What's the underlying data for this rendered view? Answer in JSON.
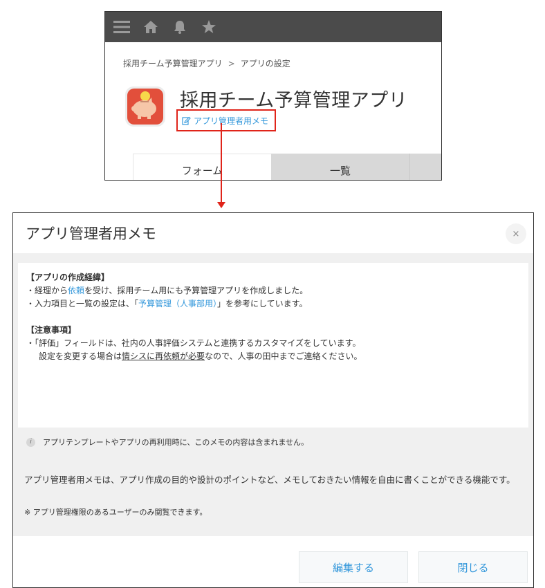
{
  "app_screen": {
    "breadcrumb": {
      "app": "採用チーム予算管理アプリ",
      "separator": ">",
      "current": "アプリの設定"
    },
    "app_title": "採用チーム予算管理アプリ",
    "memo_link_label": "アプリ管理者用メモ",
    "tabs": [
      {
        "label": "フォーム",
        "active": true
      },
      {
        "label": "一覧",
        "active": false
      }
    ],
    "topbar_icons": [
      "menu-icon",
      "home-icon",
      "bell-icon",
      "star-icon"
    ],
    "topbar_color": "#4b4b4b",
    "highlight_color": "#e0241a"
  },
  "dialog": {
    "title": "アプリ管理者用メモ",
    "close_symbol": "×",
    "memo": {
      "heading1": "【アプリの作成経緯】",
      "line1_pre": "・経理から",
      "line1_link": "依頼",
      "line1_post": "を受け、採用チーム用にも予算管理アプリを作成しました。",
      "line2_pre": "・入力項目と一覧の設定は、「",
      "line2_link": "予算管理（人事部用）",
      "line2_post": "」を参考にしています。",
      "heading2": "【注意事項】",
      "line3": "・「評価」フィールドは、社内の人事評価システムと連携するカスタマイズをしています。",
      "line4_pre": "設定を変更する場合は",
      "line4_underline": "情シスに再依頼が必要",
      "line4_post": "なので、人事の田中までご連絡ください。"
    },
    "note_icon": "info-icon",
    "note_text": "アプリテンプレートやアプリの再利用時に、このメモの内容は含まれません。",
    "description": "アプリ管理者用メモは、アプリ作成の目的や設計のポイントなど、メモしておきたい情報を自由に書くことができる機能です。",
    "permission_note": "※ アプリ管理権限のあるユーザーのみ閲覧できます。",
    "buttons": {
      "edit": "編集する",
      "close": "閉じる"
    },
    "link_color": "#3498db"
  }
}
